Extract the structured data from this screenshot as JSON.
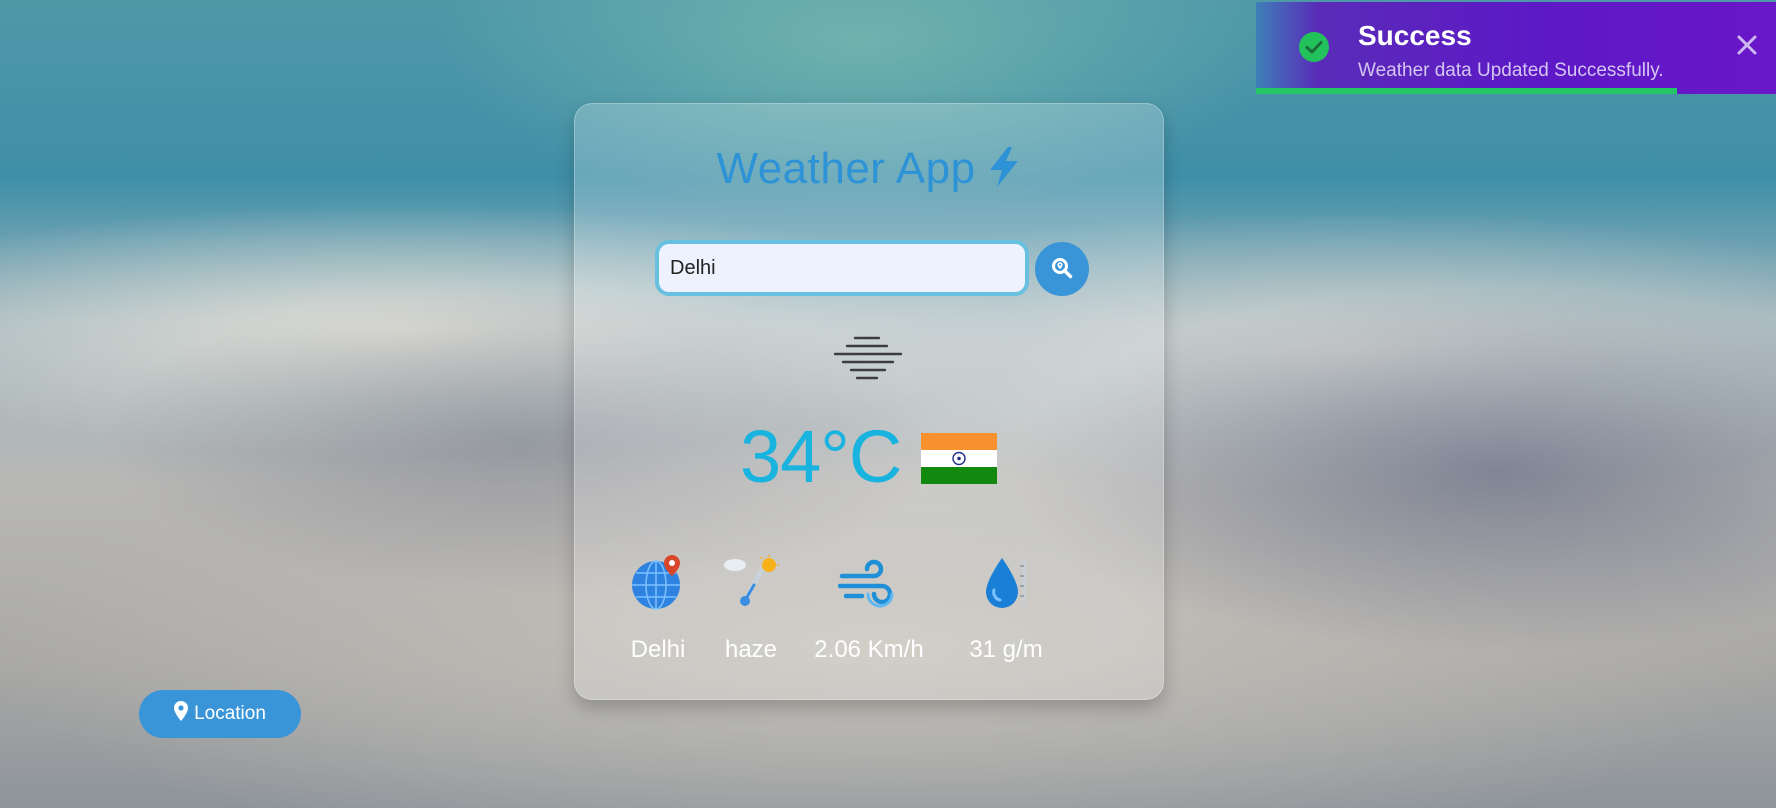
{
  "app": {
    "title": "Weather App",
    "accent_color": "#2e93d6"
  },
  "search": {
    "value": "Delhi",
    "button_icon": "search-location-icon"
  },
  "current": {
    "condition_icon": "haze-icon",
    "temperature": "34°C",
    "country_flag": "india-flag"
  },
  "stats": [
    {
      "icon": "globe-location-icon",
      "value": "Delhi"
    },
    {
      "icon": "weather-thermometer-icon",
      "value": "haze"
    },
    {
      "icon": "wind-icon",
      "value": "2.06 Km/h"
    },
    {
      "icon": "humidity-drop-icon",
      "value": "31 g/m"
    }
  ],
  "location_button": {
    "label": "Location",
    "icon": "map-pin-icon"
  },
  "toast": {
    "title": "Success",
    "message": "Weather data Updated Successfully.",
    "status_color": "#24c765",
    "progress": 0.81
  }
}
